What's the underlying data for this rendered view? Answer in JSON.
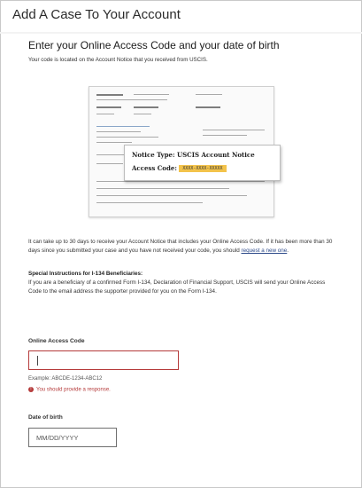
{
  "page_title": "Add A Case To Your Account",
  "section": {
    "heading": "Enter your Online Access Code and your date of birth",
    "subtext": "Your code is located on the Account Notice that you received from USCIS."
  },
  "notice_image": {
    "notice_type_label": "Notice Type:",
    "notice_type_value": "USCIS Account Notice",
    "access_code_label": "Access Code:",
    "access_code_value": "XXXX-XXXX-XXXXX"
  },
  "info": {
    "text": "It can take up to 30 days to receive your Account Notice that includes your Online Access Code. If it has been more than 30 days since you submitted your case and you have not received your code, you should",
    "link": "request a new one",
    "end": "."
  },
  "special": {
    "title": "Special Instructions for I-134 Beneficiaries:",
    "text": "If you are a beneficiary of a confirmed Form I-134, Declaration of Financial Support, USCIS will send your Online Access Code to the email address the supporter provided for you on the Form I-134."
  },
  "access_code_field": {
    "label": "Online Access Code",
    "value": "",
    "hint": "Example: ABCDE-1234-ABC12",
    "error": "You should provide a response.",
    "error_icon": "!"
  },
  "dob_field": {
    "label": "Date of birth",
    "placeholder": "MM/DD/YYYY"
  },
  "colors": {
    "error": "#b53a3a",
    "link": "#2d4a8a",
    "highlight": "#f3c34b"
  }
}
